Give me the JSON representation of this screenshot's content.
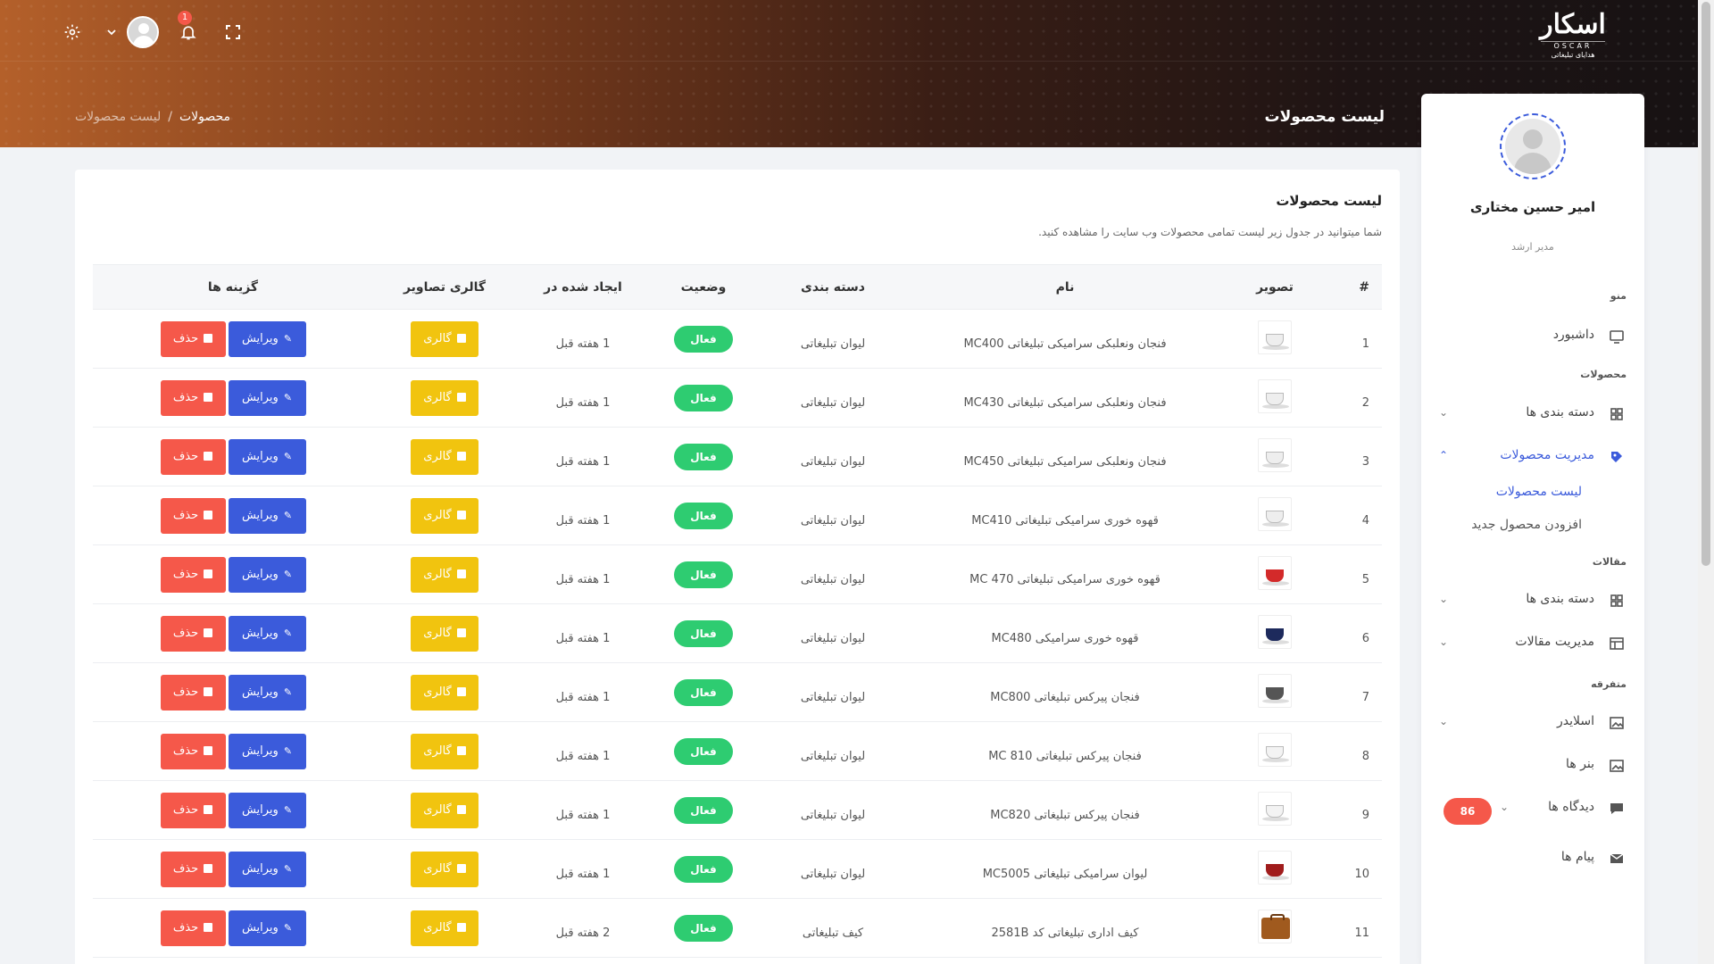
{
  "header": {
    "logo": {
      "mark": "اسکار",
      "sub": "OSCAR",
      "tag": "هدایای تبلیغاتی"
    },
    "notification_count": "1",
    "page_title": "لیست محصولات",
    "breadcrumb": {
      "parent": "محصولات",
      "current": "لیست محصولات",
      "separator": "/"
    }
  },
  "sidebar": {
    "user_name": "امیر حسین مختاری",
    "user_role": "مدیر ارشد",
    "sections": {
      "menu": "منو",
      "products": "محصولات",
      "articles": "مقالات",
      "misc": "متفرقه"
    },
    "items": {
      "dashboard": "داشبورد",
      "product_categories": "دسته بندی ها",
      "product_management": "مدیریت محصولات",
      "product_list": "لیست محصولات",
      "add_product": "افزودن محصول جدید",
      "article_categories": "دسته بندی ها",
      "article_management": "مدیریت مقالات",
      "slider": "اسلایدر",
      "banners": "بنر ها",
      "comments": "دیدگاه ها",
      "messages": "پیام ها"
    },
    "comments_count": "86"
  },
  "card": {
    "title": "لیست محصولات",
    "description": "شما میتوانید در جدول زیر لیست تمامی محصولات وب سایت را مشاهده کنید."
  },
  "table": {
    "headers": {
      "num": "#",
      "image": "تصویر",
      "name": "نام",
      "category": "دسته بندی",
      "status": "وضعیت",
      "created": "ایجاد شده در",
      "gallery": "گالری تصاویر",
      "options": "گزینه ها"
    },
    "labels": {
      "gallery": "گالری",
      "edit": "ویرایش",
      "delete": "حذف"
    },
    "rows": [
      {
        "num": "1",
        "name": "فنجان ونعلبکی سرامیکی تبلیغاتی MC400",
        "category": "لیوان تبلیغاتی",
        "status": "فعال",
        "created": "1 هفته قبل",
        "thumb": "white-cup"
      },
      {
        "num": "2",
        "name": "فنجان ونعلبکی سرامیکی تبلیغاتی MC430",
        "category": "لیوان تبلیغاتی",
        "status": "فعال",
        "created": "1 هفته قبل",
        "thumb": "white-cup"
      },
      {
        "num": "3",
        "name": "فنجان ونعلبکی سرامیکی تبلیغاتی MC450",
        "category": "لیوان تبلیغاتی",
        "status": "فعال",
        "created": "1 هفته قبل",
        "thumb": "white-cup"
      },
      {
        "num": "4",
        "name": "قهوه خوری سرامیکی تبلیغاتی MC410",
        "category": "لیوان تبلیغاتی",
        "status": "فعال",
        "created": "1 هفته قبل",
        "thumb": "white-cup"
      },
      {
        "num": "5",
        "name": "قهوه خوری سرامیکی تبلیغاتی MC 470",
        "category": "لیوان تبلیغاتی",
        "status": "فعال",
        "created": "1 هفته قبل",
        "thumb": "red-cup"
      },
      {
        "num": "6",
        "name": "قهوه خوری سرامیکی MC480",
        "category": "لیوان تبلیغاتی",
        "status": "فعال",
        "created": "1 هفته قبل",
        "thumb": "navy-cup"
      },
      {
        "num": "7",
        "name": "فنجان پیرکس تبلیغاتی MC800",
        "category": "لیوان تبلیغاتی",
        "status": "فعال",
        "created": "1 هفته قبل",
        "thumb": "grey-mug"
      },
      {
        "num": "8",
        "name": "فنجان پیرکس تبلیغاتی MC 810",
        "category": "لیوان تبلیغاتی",
        "status": "فعال",
        "created": "1 هفته قبل",
        "thumb": "white-mug"
      },
      {
        "num": "9",
        "name": "فنجان پیرکس تبلیغاتی MC820",
        "category": "لیوان تبلیغاتی",
        "status": "فعال",
        "created": "1 هفته قبل",
        "thumb": "white-mug"
      },
      {
        "num": "10",
        "name": "لیوان سرامیکی تبلیغاتی MC5005",
        "category": "لیوان تبلیغاتی",
        "status": "فعال",
        "created": "1 هفته قبل",
        "thumb": "red-mug"
      },
      {
        "num": "11",
        "name": "کیف اداری تبلیغاتی کد 2581B",
        "category": "کیف تبلیغاتی",
        "status": "فعال",
        "created": "2 هفته قبل",
        "thumb": "bag"
      }
    ]
  },
  "colors": {
    "primary": "#3b5bdb",
    "success": "#2ecc71",
    "warning": "#f1c40f",
    "danger": "#f5584a"
  }
}
